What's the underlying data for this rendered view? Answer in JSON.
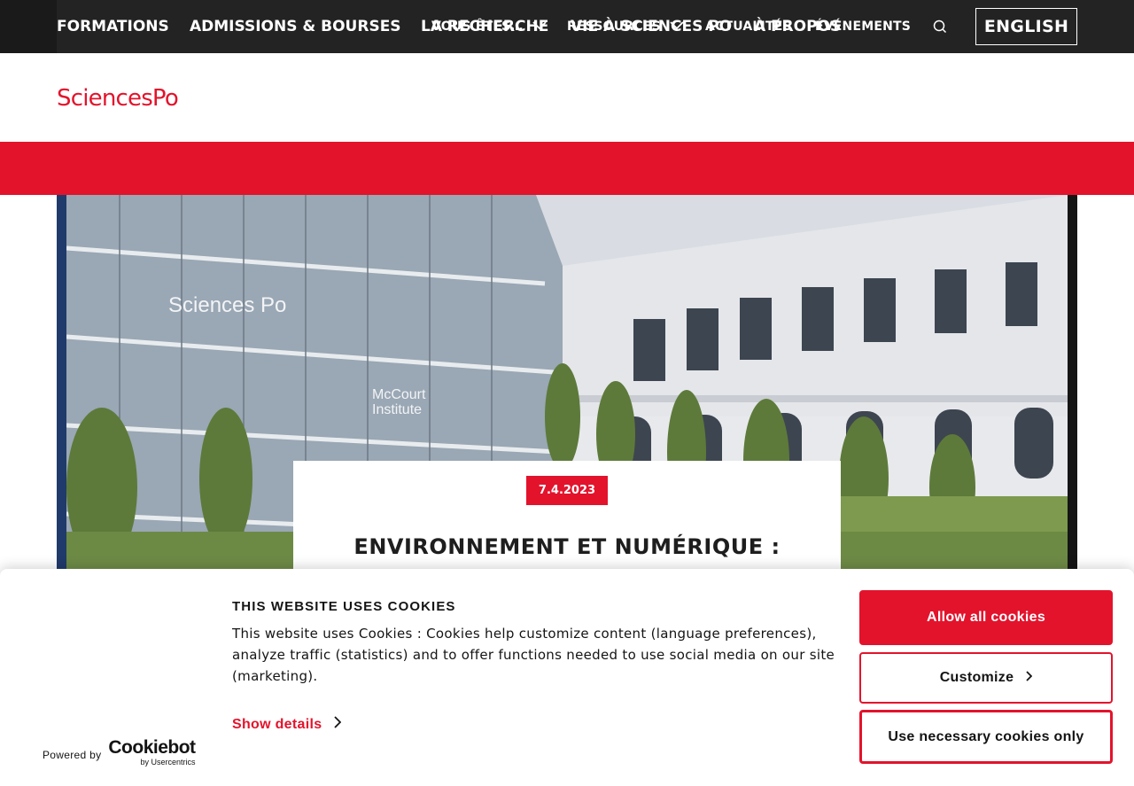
{
  "topbar": {
    "items": [
      {
        "label": "VOUS ÊTES…",
        "has_dropdown": true
      },
      {
        "label": "RESSOURCES",
        "has_dropdown": true
      },
      {
        "label": "ACTUALITÉS",
        "has_dropdown": false
      },
      {
        "label": "ÉVÉNEMENTS",
        "has_dropdown": false
      }
    ],
    "search_icon": "search-icon",
    "language_button": "ENGLISH"
  },
  "brand": {
    "logo_text": "SciencesPo",
    "color": "#e3132c"
  },
  "main_nav": {
    "items": [
      {
        "label": "FORMATIONS"
      },
      {
        "label": "ADMISSIONS & BOURSES"
      },
      {
        "label": "LA RECHERCHE"
      },
      {
        "label": "VIE À SCIENCES PO"
      },
      {
        "label": "À PROPOS"
      }
    ]
  },
  "hero": {
    "image_signs": {
      "building_sign": "Sciences Po",
      "institute_sign_line1": "McCourt",
      "institute_sign_line2": "Institute"
    },
    "article": {
      "date": "7.4.2023",
      "title": "ENVIRONNEMENT ET NUMÉRIQUE :"
    }
  },
  "cookie_banner": {
    "title": "THIS WEBSITE USES COOKIES",
    "text": "This website uses Cookies : Cookies help customize content (language preferences), analyze traffic (statistics) and to offer functions needed to use social media on our site (marketing).",
    "show_details": "Show details",
    "buttons": {
      "allow_all": "Allow all cookies",
      "customize": "Customize",
      "necessary_only": "Use necessary cookies only"
    },
    "powered_by": "Powered by",
    "provider_name": "Cookiebot",
    "provider_sub": "by Usercentrics"
  },
  "colors": {
    "accent": "#e3132c",
    "topbar": "#232323"
  }
}
